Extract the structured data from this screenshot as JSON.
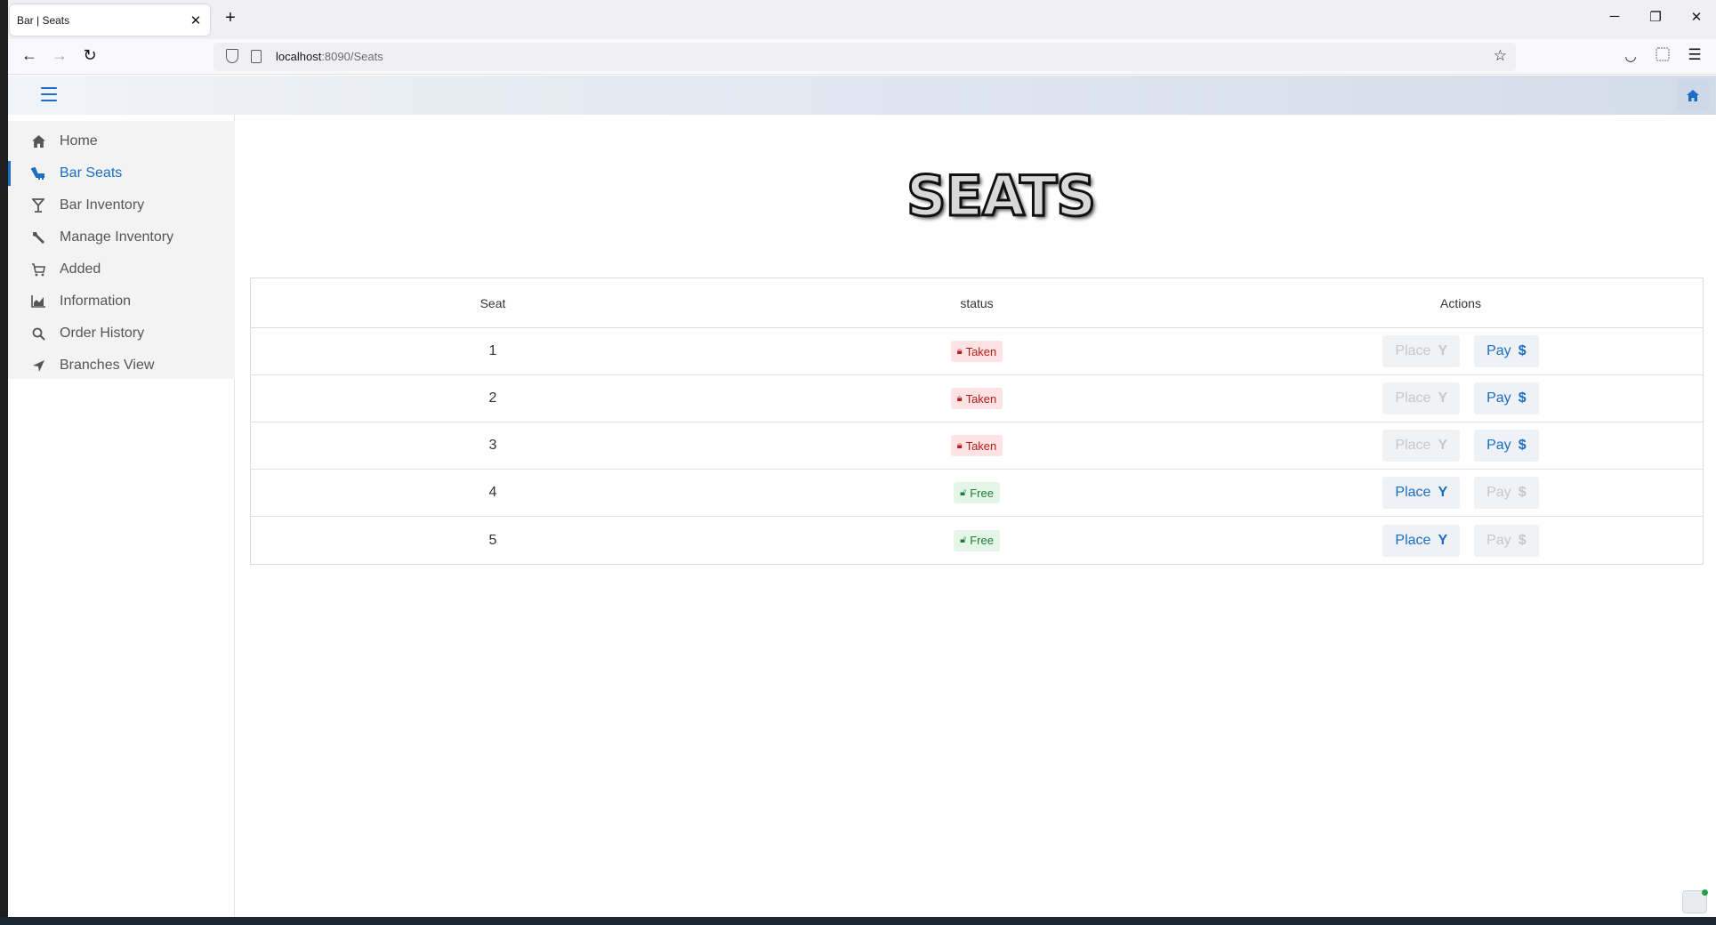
{
  "browser": {
    "tab_title": "Bar | Seats",
    "tab_close": "✕",
    "new_tab": "+",
    "url_host": "localhost",
    "url_path": ":8090/Seats",
    "window_controls": [
      "─",
      "❐",
      "✕"
    ]
  },
  "sidebar": {
    "items": [
      {
        "label": "Home",
        "icon": "home-icon",
        "active": false
      },
      {
        "label": "Bar Seats",
        "icon": "seat-icon",
        "active": true
      },
      {
        "label": "Bar Inventory",
        "icon": "cocktail-icon",
        "active": false
      },
      {
        "label": "Manage Inventory",
        "icon": "wrench-icon",
        "active": false
      },
      {
        "label": "Added",
        "icon": "cart-icon",
        "active": false
      },
      {
        "label": "Information",
        "icon": "chart-icon",
        "active": false
      },
      {
        "label": "Order History",
        "icon": "search-icon",
        "active": false
      },
      {
        "label": "Branches View",
        "icon": "location-arrow-icon",
        "active": false
      }
    ]
  },
  "page": {
    "title": "SEATS"
  },
  "table": {
    "headers": {
      "seat": "Seat",
      "status": "status",
      "actions": "Actions"
    },
    "rows": [
      {
        "seat": "1",
        "status": "Taken",
        "place_label": "Place",
        "pay_label": "Pay"
      },
      {
        "seat": "2",
        "status": "Taken",
        "place_label": "Place",
        "pay_label": "Pay"
      },
      {
        "seat": "3",
        "status": "Taken",
        "place_label": "Place",
        "pay_label": "Pay"
      },
      {
        "seat": "4",
        "status": "Free",
        "place_label": "Place",
        "pay_label": "Pay"
      },
      {
        "seat": "5",
        "status": "Free",
        "place_label": "Place",
        "pay_label": "Pay"
      }
    ]
  },
  "colors": {
    "accent": "#1b6ec2",
    "taken_bg": "#fde3e3",
    "taken_text": "#b81b1b",
    "free_bg": "#e4f6e8",
    "free_text": "#1e7e34"
  }
}
